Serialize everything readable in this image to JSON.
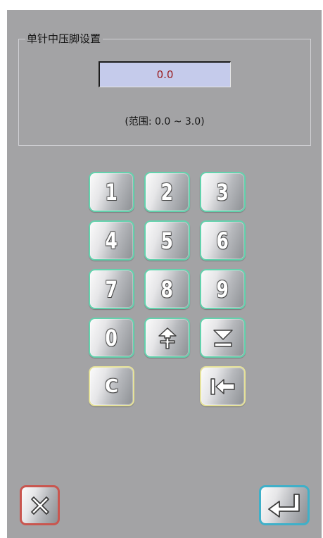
{
  "dialog": {
    "title": "单针中压脚设置",
    "value": "0.0",
    "range_text": "(范围: 0.0 ~ 3.0)"
  },
  "keypad": {
    "keys": [
      "1",
      "2",
      "3",
      "4",
      "5",
      "6",
      "7",
      "8",
      "9",
      "0"
    ],
    "increment_icon": "plus-arrow-up-icon",
    "decrement_icon": "minus-arrow-down-icon",
    "clear_label": "C",
    "backspace_icon": "backspace-arrow-icon"
  },
  "footer": {
    "cancel_icon": "close-x-icon",
    "confirm_icon": "enter-return-icon"
  },
  "colors": {
    "screen_bg": "#a3a3a5",
    "value_bg": "#c5cbeb",
    "value_text": "#9a1f22",
    "key_border": "#63d2ad",
    "special_key_border": "#e6e29a",
    "cancel_border": "#c9564f",
    "confirm_border": "#3fb0c9"
  }
}
